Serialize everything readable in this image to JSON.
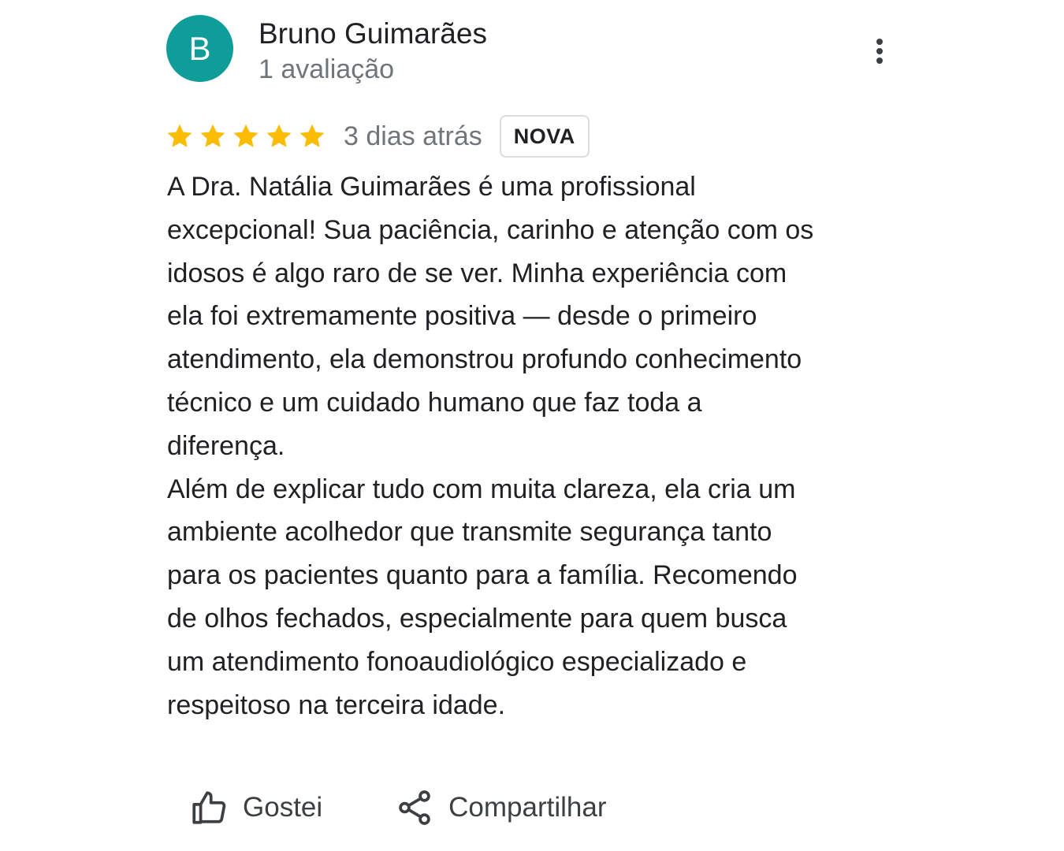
{
  "author": {
    "initial": "B",
    "name": "Bruno Guimarães",
    "meta": "1 avaliação"
  },
  "rating": {
    "stars": 5,
    "max_stars": 5,
    "time": "3 dias atrás",
    "badge": "NOVA"
  },
  "colors": {
    "avatar": "#0f9d9a",
    "star": "#fbbc04",
    "muted_text": "#70757a"
  },
  "review": {
    "paragraph_1": "A Dra. Natália Guimarães é uma profissional\nexcepcional! Sua paciência, carinho e atenção com os\nidosos é algo raro de se ver. Minha experiência com\nela foi extremamente positiva — desde o primeiro\natendimento, ela demonstrou profundo conhecimento\ntécnico e um cuidado humano que faz toda a\ndiferença.",
    "paragraph_2": "Além de explicar tudo com muita clareza, ela cria um\nambiente acolhedor que transmite segurança tanto\npara os pacientes quanto para a família. Recomendo\nde olhos fechados, especialmente para quem busca\num atendimento fonoaudiológico especializado e\nrespeitoso na terceira idade."
  },
  "actions": {
    "like_label": "Gostei",
    "like_icon": "thumbs-up-icon",
    "share_label": "Compartilhar",
    "share_icon": "share-icon",
    "more_icon": "more-vert-icon"
  }
}
